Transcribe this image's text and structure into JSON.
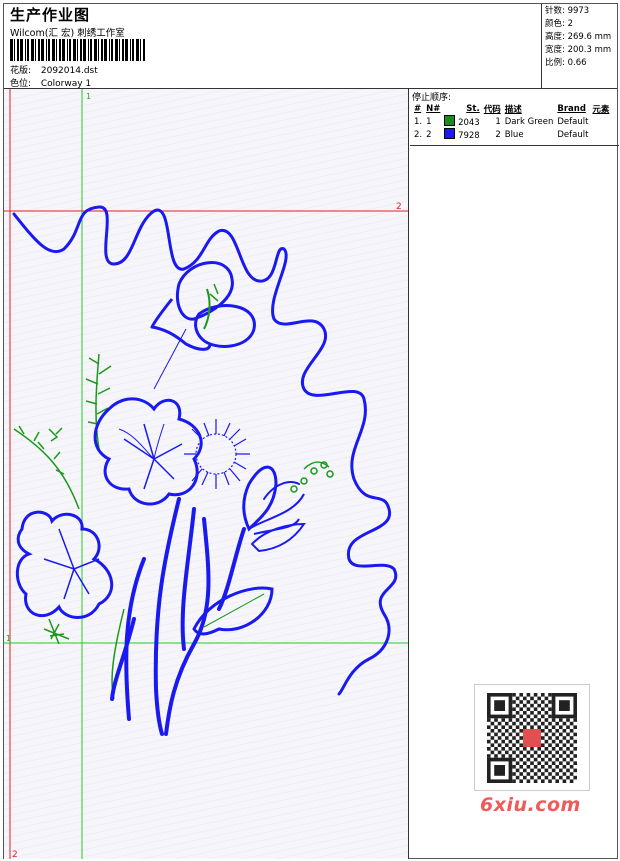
{
  "header": {
    "title": "生产作业图",
    "company": "Wilcom(汇 宏) 刺绣工作室",
    "design_label": "花版:",
    "design_value": "2092014.dst",
    "colorway_label": "色位:",
    "colorway_value": "Colorway 1"
  },
  "stats": [
    {
      "label": "针数:",
      "value": "9973"
    },
    {
      "label": "颜色:",
      "value": "2"
    },
    {
      "label": "高度:",
      "value": "269.6 mm"
    },
    {
      "label": "宽度:",
      "value": "200.3 mm"
    },
    {
      "label": "比例:",
      "value": "0.66"
    }
  ],
  "stop_sequence": {
    "title": "停止顺序:",
    "headers": [
      "#",
      "N#",
      "St.",
      "代码",
      "描述",
      "Brand",
      "元素"
    ],
    "rows": [
      {
        "index": "1.",
        "n": "1",
        "color_hex": "#1a8a1a",
        "code": "2043",
        "stitch": "1",
        "description": "Dark Green",
        "brand": "Default"
      },
      {
        "index": "2.",
        "n": "2",
        "color_hex": "#1a1af0",
        "code": "7928",
        "stitch": "2",
        "description": "Blue",
        "brand": "Default"
      }
    ]
  },
  "guides": {
    "v1_label": "1",
    "h2_label_right": "2",
    "h1_label_left": "1",
    "v2_label_bottom": "2"
  },
  "watermark": "6xiu.com",
  "colors": {
    "guide_green": "#22cc22",
    "guide_red": "#dd2222",
    "thread_blue": "#1a1af0",
    "thread_green": "#1a9a1a"
  }
}
